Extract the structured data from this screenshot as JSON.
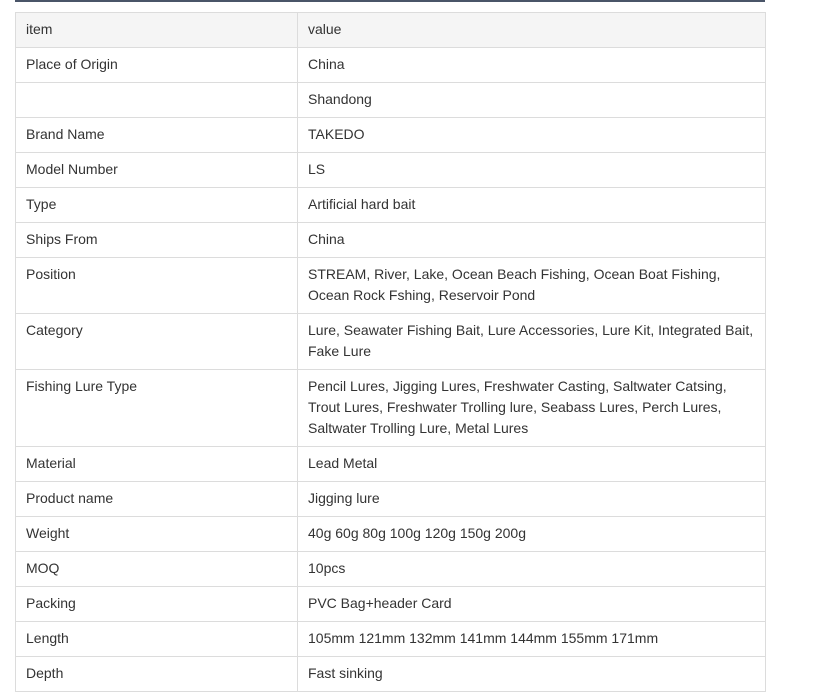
{
  "table": {
    "header": {
      "item": "item",
      "value": "value"
    },
    "rows": [
      {
        "item": "Place of Origin",
        "value": "China"
      },
      {
        "item": "",
        "value": "Shandong"
      },
      {
        "item": "Brand Name",
        "value": "TAKEDO"
      },
      {
        "item": "Model Number",
        "value": "LS"
      },
      {
        "item": "Type",
        "value": "Artificial hard bait"
      },
      {
        "item": "Ships From",
        "value": "China"
      },
      {
        "item": "Position",
        "value": "STREAM, River, Lake, Ocean Beach Fishing, Ocean Boat Fishing, Ocean Rock Fshing, Reservoir Pond"
      },
      {
        "item": "Category",
        "value": "Lure, Seawater Fishing Bait, Lure Accessories, Lure Kit, Integrated Bait, Fake Lure"
      },
      {
        "item": "Fishing Lure Type",
        "value": "Pencil Lures, Jigging Lures, Freshwater Casting, Saltwater Catsing, Trout Lures, Freshwater Trolling lure, Seabass Lures, Perch Lures, Saltwater Trolling Lure, Metal Lures"
      },
      {
        "item": "Material",
        "value": "Lead Metal"
      },
      {
        "item": "Product name",
        "value": "Jigging lure"
      },
      {
        "item": "Weight",
        "value": "40g 60g 80g 100g 120g 150g 200g"
      },
      {
        "item": "MOQ",
        "value": "10pcs"
      },
      {
        "item": "Packing",
        "value": "PVC Bag+header Card"
      },
      {
        "item": "Length",
        "value": "105mm 121mm 132mm 141mm 144mm 155mm 171mm"
      },
      {
        "item": "Depth",
        "value": "Fast sinking"
      }
    ]
  }
}
